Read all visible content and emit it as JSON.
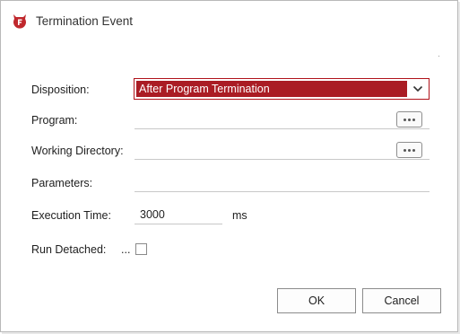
{
  "window": {
    "title": "Termination Event"
  },
  "form": {
    "disposition": {
      "label": "Disposition:",
      "value": "After Program Termination"
    },
    "program": {
      "label": "Program:",
      "value": ""
    },
    "working_directory": {
      "label": "Working Directory:",
      "value": ""
    },
    "parameters": {
      "label": "Parameters:",
      "value": ""
    },
    "execution_time": {
      "label": "Execution Time:",
      "value": "3000",
      "unit": "ms"
    },
    "run_detached": {
      "label": "Run Detached:",
      "prefix": "...",
      "checked": false
    }
  },
  "buttons": {
    "ok": "OK",
    "cancel": "Cancel"
  },
  "colors": {
    "accent": "#aa1c24",
    "border": "#b0121a"
  },
  "icons": {
    "app": "app-logo-icon",
    "dropdown": "chevron-down-icon",
    "browse": "ellipsis-icon"
  }
}
